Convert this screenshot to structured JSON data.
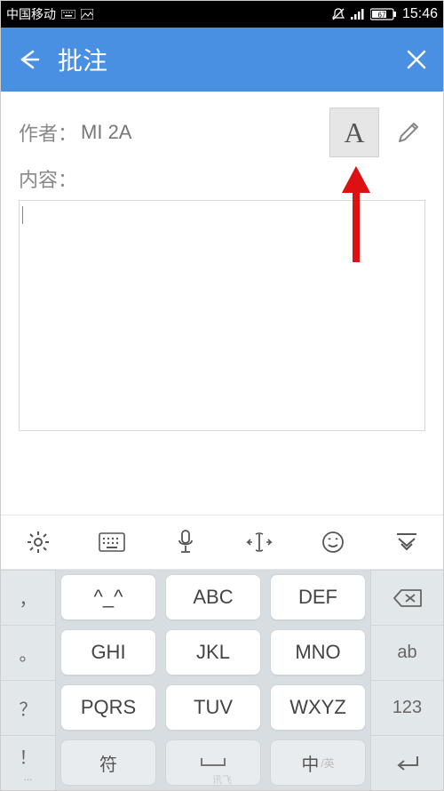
{
  "status_bar": {
    "carrier": "中国移动",
    "battery": "67",
    "time": "15:46"
  },
  "header": {
    "title": "批注"
  },
  "meta": {
    "author_label": "作者：",
    "author_value": "MI 2A",
    "content_label": "内容：",
    "text_tool": "A"
  },
  "keyboard": {
    "side": [
      "，",
      "。",
      "？",
      "！"
    ],
    "side_more": "...",
    "keys": [
      [
        "^_^",
        "ABC",
        "DEF"
      ],
      [
        "GHI",
        "JKL",
        "MNO"
      ],
      [
        "PQRS",
        "TUV",
        "WXYZ"
      ]
    ],
    "right": {
      "ab": "ab",
      "num": "123"
    },
    "bottom": {
      "symbol": "符",
      "cn": "中",
      "en": "/英"
    },
    "ime_brand": "讯飞"
  }
}
